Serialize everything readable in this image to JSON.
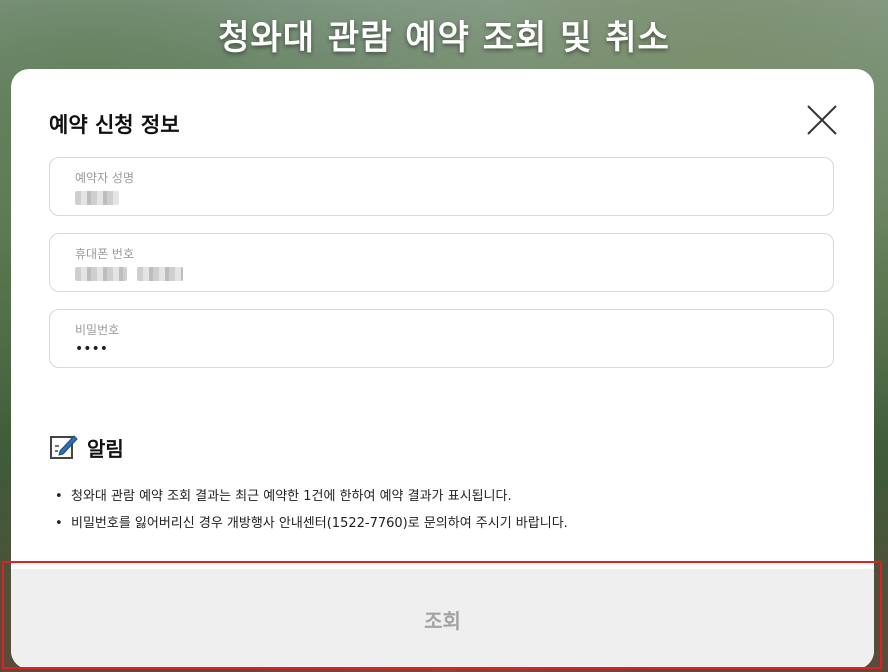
{
  "page": {
    "title": "청와대 관람 예약 조회 및 취소"
  },
  "modal": {
    "section_title": "예약 신청 정보",
    "close_icon": "close-icon",
    "fields": [
      {
        "label": "예약자 성명",
        "value": "",
        "obscured": true
      },
      {
        "label": "휴대폰 번호",
        "value": "",
        "obscured": true
      },
      {
        "label": "비밀번호",
        "value": "••••",
        "obscured": false
      }
    ],
    "notice": {
      "icon": "pencil-note-icon",
      "title": "알림",
      "items": [
        "청와대 관람 예약 조회 결과는 최근 예약한 1건에 한하여 예약 결과가 표시됩니다.",
        "비밀번호를 잃어버리신 경우 개방행사 안내센터(1522-7760)로 문의하여 주시기 바랍니다."
      ]
    },
    "search_button": "조회"
  },
  "colors": {
    "highlight": "#e31e24",
    "button_bg": "#efefef",
    "button_text": "#a3a3a3"
  }
}
